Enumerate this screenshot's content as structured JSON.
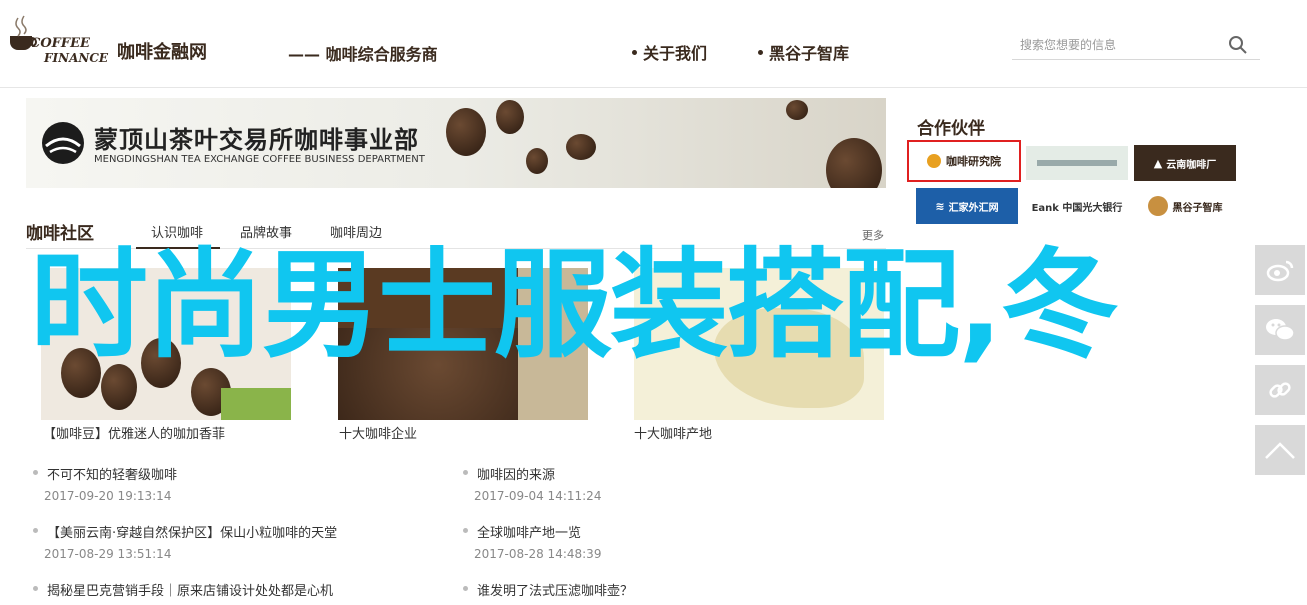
{
  "header": {
    "logo_line1": "COFFEE",
    "logo_line2": "FINANCE",
    "site_name": "咖啡金融网",
    "site_sub": "—— 咖啡综合服务商",
    "nav": [
      {
        "label": "关于我们"
      },
      {
        "label": "黑谷子智库"
      }
    ],
    "search_placeholder": "搜索您想要的信息",
    "search_icon": "search-icon"
  },
  "banner": {
    "title_cn": "蒙顶山茶叶交易所咖啡事业部",
    "title_en": "MENGDINGSHAN TEA EXCHANGE COFFEE BUSINESS DEPARTMENT"
  },
  "partners": {
    "title": "合作伙伴",
    "items": [
      {
        "label": "咖啡研究院"
      },
      {
        "label": ""
      },
      {
        "label": "云南咖啡厂"
      },
      {
        "label": "汇家外汇网"
      },
      {
        "label": "Eank 中国光大银行"
      },
      {
        "label": "黑谷子智库"
      }
    ]
  },
  "community": {
    "title": "咖啡社区",
    "tabs": [
      {
        "label": "认识咖啡"
      },
      {
        "label": "品牌故事"
      },
      {
        "label": "咖啡周边"
      }
    ],
    "more": "更多",
    "cards": [
      {
        "caption": "【咖啡豆】优雅迷人的咖加香菲"
      },
      {
        "caption": "十大咖啡企业"
      },
      {
        "caption": "十大咖啡产地"
      }
    ],
    "news_left": [
      {
        "title": "不可不知的轻奢级咖啡",
        "time": "2017-09-20 19:13:14"
      },
      {
        "title": "【美丽云南·穿越自然保护区】保山小粒咖啡的天堂",
        "time": "2017-08-29 13:51:14"
      },
      {
        "title": "揭秘星巴克营销手段｜原来店铺设计处处都是心机",
        "time": ""
      }
    ],
    "news_right": [
      {
        "title": "咖啡因的来源",
        "time": "2017-09-04 14:11:24"
      },
      {
        "title": "全球咖啡产地一览",
        "time": "2017-08-28 14:48:39"
      },
      {
        "title": "谁发明了法式压滤咖啡壶？",
        "time": ""
      }
    ]
  },
  "overlay_text": "时尚男士服装搭配,冬",
  "share": [
    {
      "icon": "weibo-icon"
    },
    {
      "icon": "wechat-icon"
    },
    {
      "icon": "link-icon"
    },
    {
      "icon": "back-to-top-icon"
    }
  ],
  "colors": {
    "brand": "#3a2a1e",
    "overlay": "#10c6f0",
    "partner_highlight": "#e02020"
  }
}
